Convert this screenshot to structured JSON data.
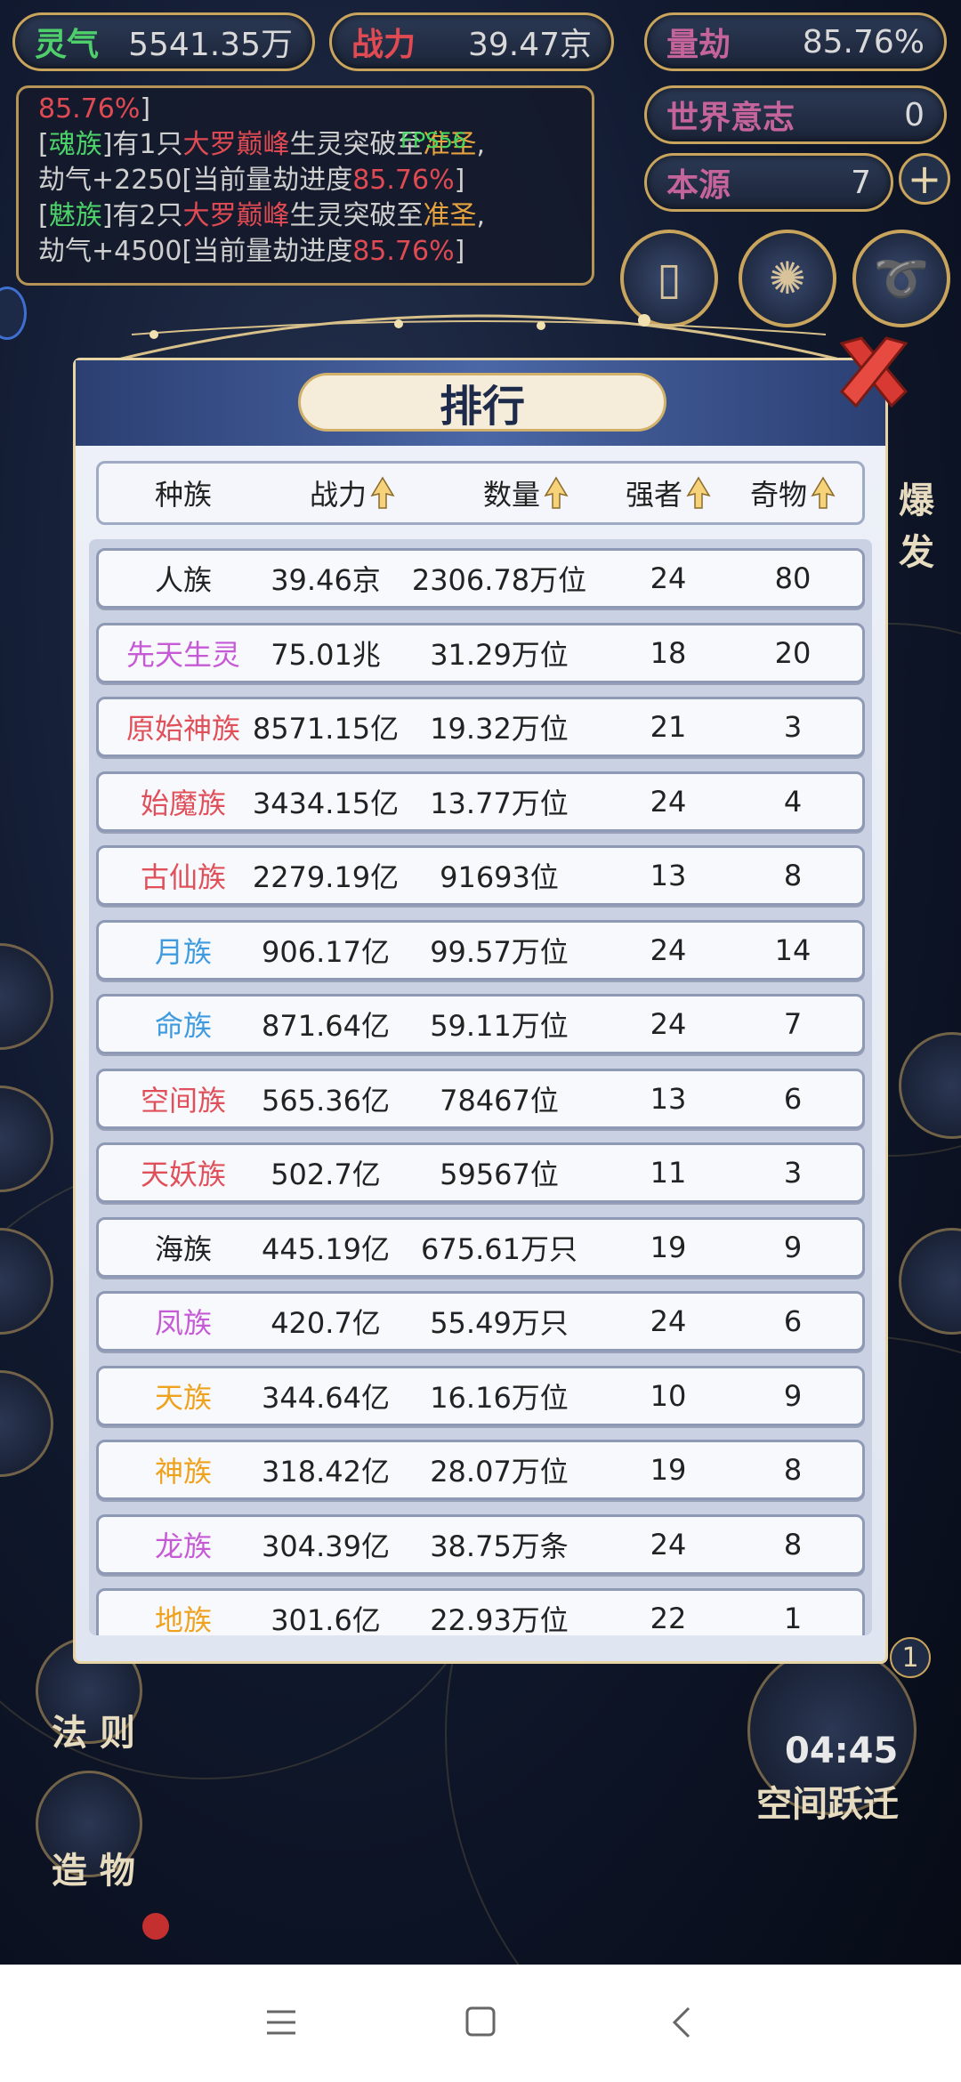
{
  "stats": {
    "lingqi": {
      "label": "灵气",
      "value": "5541.35万"
    },
    "zhanli": {
      "label": "战力",
      "value": "39.47京"
    },
    "liangjie": {
      "label": "量劫",
      "value": "85.76%"
    },
    "shijie": {
      "label": "世界意志",
      "value": "0"
    },
    "benyuan": {
      "label": "本源",
      "value": "7"
    }
  },
  "log": {
    "l0_pct": "85.76%",
    "l0_end": "]",
    "l1_a": "[",
    "l1_race": "魂族",
    "l1_b": "]有1只",
    "l1_level": "大罗巅峰",
    "l1_c": "生灵突破至",
    "l1_rank": "准圣",
    "l1_d": ",",
    "l2_a": "劫气+2250[当前量劫进度",
    "l2_pct": "85.76%",
    "l2_b": "]",
    "l3_a": "[",
    "l3_race": "魅族",
    "l3_b": "]有2只",
    "l3_level": "大罗巅峰",
    "l3_c": "生灵突破至",
    "l3_rank": "准圣",
    "l3_d": ",",
    "l4_a": "劫气+4500[当前量劫进度",
    "l4_pct": "85.76%",
    "l4_b": "]"
  },
  "fps": "FPS56",
  "side": {
    "burst": "爆发",
    "fa": "法 则",
    "zao": "造 物",
    "timer": "04:45",
    "leap": "空间跃迁",
    "badge": "1"
  },
  "modal": {
    "title": "排行",
    "columns": [
      "种族",
      "战力",
      "数量",
      "强者",
      "奇物"
    ],
    "rows": [
      {
        "race": "人族",
        "color": "#222222",
        "power": "39.46京",
        "count": "2306.78万位",
        "strong": "24",
        "items": "80"
      },
      {
        "race": "先天生灵",
        "color": "#c65ad6",
        "power": "75.01兆",
        "count": "31.29万位",
        "strong": "18",
        "items": "20"
      },
      {
        "race": "原始神族",
        "color": "#e0505a",
        "power": "8571.15亿",
        "count": "19.32万位",
        "strong": "21",
        "items": "3"
      },
      {
        "race": "始魔族",
        "color": "#e0505a",
        "power": "3434.15亿",
        "count": "13.77万位",
        "strong": "24",
        "items": "4"
      },
      {
        "race": "古仙族",
        "color": "#e0505a",
        "power": "2279.19亿",
        "count": "91693位",
        "strong": "13",
        "items": "8"
      },
      {
        "race": "月族",
        "color": "#3f9be0",
        "power": "906.17亿",
        "count": "99.57万位",
        "strong": "24",
        "items": "14"
      },
      {
        "race": "命族",
        "color": "#3f9be0",
        "power": "871.64亿",
        "count": "59.11万位",
        "strong": "24",
        "items": "7"
      },
      {
        "race": "空间族",
        "color": "#e0505a",
        "power": "565.36亿",
        "count": "78467位",
        "strong": "13",
        "items": "6"
      },
      {
        "race": "天妖族",
        "color": "#e0505a",
        "power": "502.7亿",
        "count": "59567位",
        "strong": "11",
        "items": "3"
      },
      {
        "race": "海族",
        "color": "#222222",
        "power": "445.19亿",
        "count": "675.61万只",
        "strong": "19",
        "items": "9"
      },
      {
        "race": "凤族",
        "color": "#c65ad6",
        "power": "420.7亿",
        "count": "55.49万只",
        "strong": "24",
        "items": "6"
      },
      {
        "race": "天族",
        "color": "#eea21d",
        "power": "344.64亿",
        "count": "16.16万位",
        "strong": "10",
        "items": "9"
      },
      {
        "race": "神族",
        "color": "#eea21d",
        "power": "318.42亿",
        "count": "28.07万位",
        "strong": "19",
        "items": "8"
      },
      {
        "race": "龙族",
        "color": "#c65ad6",
        "power": "304.39亿",
        "count": "38.75万条",
        "strong": "24",
        "items": "8"
      },
      {
        "race": "地族",
        "color": "#eea21d",
        "power": "301.6亿",
        "count": "22.93万位",
        "strong": "22",
        "items": "1"
      }
    ]
  },
  "nav": {
    "menu_icon": "menu-icon",
    "home_icon": "square-icon",
    "back_icon": "back-icon"
  }
}
